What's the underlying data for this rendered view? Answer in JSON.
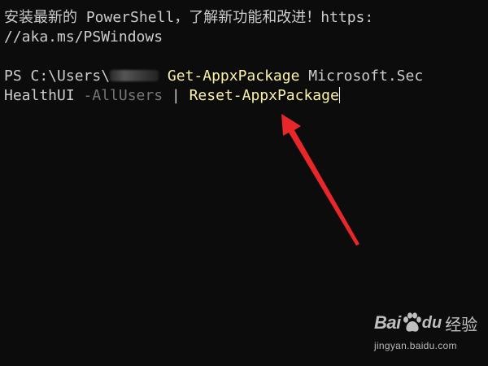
{
  "terminal": {
    "banner_line1": "安装最新的 PowerShell，了解新功能和改进！https:",
    "banner_line2": "//aka.ms/PSWindows",
    "prompt_prefix": "PS C:\\Users\\",
    "prompt_suffix": " ",
    "command_part1": "Get-AppxPackage",
    "argument_part1": " Microsoft.Sec",
    "argument_part2": "HealthUI",
    "parameter": " -AllUsers",
    "pipe": " | ",
    "command_part2": "Reset-AppxPackage"
  },
  "colors": {
    "background": "#0c0c0c",
    "text": "#cccccc",
    "command": "#f9f1a5",
    "parameter": "#767676",
    "arrow": "#e8272b"
  },
  "watermark": {
    "bai": "Bai",
    "du": "du",
    "jingyan": "经验",
    "url": "jingyan.baidu.com"
  }
}
